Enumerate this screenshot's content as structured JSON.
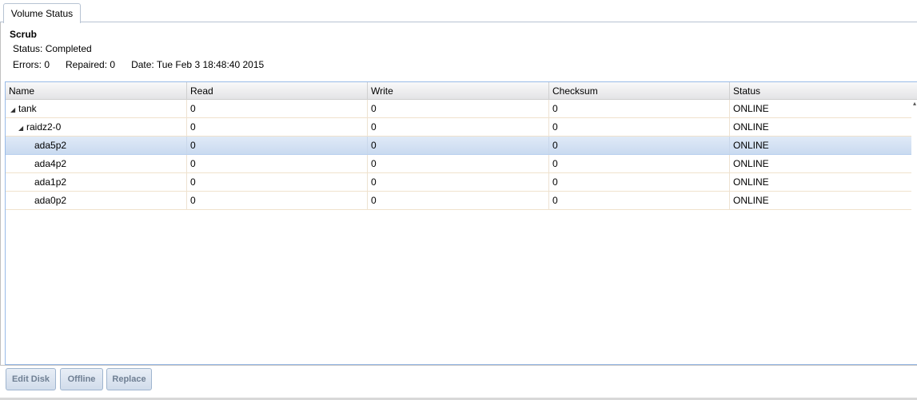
{
  "tabs": [
    {
      "label": "Volume Status"
    }
  ],
  "scrub": {
    "title": "Scrub",
    "status": "Status: Completed",
    "errors": "Errors: 0",
    "repaired": "Repaired: 0",
    "date": "Date: Tue Feb 3 18:48:40 2015"
  },
  "grid": {
    "columns": [
      "Name",
      "Read",
      "Write",
      "Checksum",
      "Status"
    ],
    "rows": [
      {
        "name": "tank",
        "read": "0",
        "write": "0",
        "checksum": "0",
        "status": "ONLINE",
        "expander": "◢"
      },
      {
        "name": "raidz2-0",
        "read": "0",
        "write": "0",
        "checksum": "0",
        "status": "ONLINE",
        "expander": "◢"
      },
      {
        "name": "ada5p2",
        "read": "0",
        "write": "0",
        "checksum": "0",
        "status": "ONLINE",
        "selected": true
      },
      {
        "name": "ada4p2",
        "read": "0",
        "write": "0",
        "checksum": "0",
        "status": "ONLINE"
      },
      {
        "name": "ada1p2",
        "read": "0",
        "write": "0",
        "checksum": "0",
        "status": "ONLINE"
      },
      {
        "name": "ada0p2",
        "read": "0",
        "write": "0",
        "checksum": "0",
        "status": "ONLINE"
      }
    ]
  },
  "toolbar": {
    "edit_disk_label": "Edit Disk",
    "offline_label": "Offline",
    "replace_label": "Replace"
  }
}
